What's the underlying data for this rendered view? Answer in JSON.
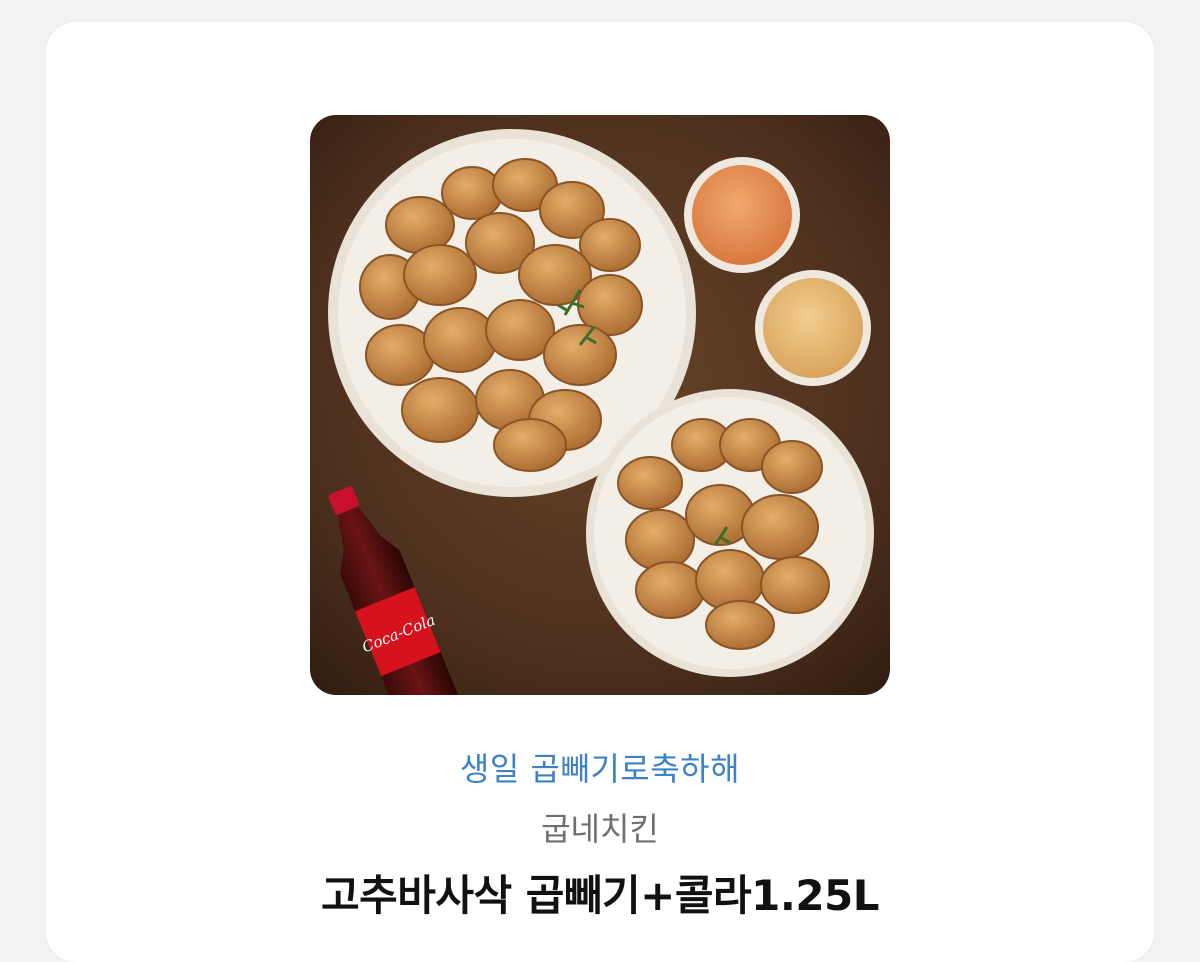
{
  "gift": {
    "image": {
      "alt": "치킨 두 접시, 소스 두 개, 콜라 1.25L",
      "bottle_label": "Coca-Cola"
    },
    "message": "생일 곱빼기로축하해",
    "brand": "굽네치킨",
    "product_name": "고추바사삭 곱빼기+콜라1.25L"
  },
  "colors": {
    "page_background": "#f2f2f4",
    "card_background": "#ffffff",
    "message_text": "#3d82c7",
    "brand_text": "#6e6e73",
    "product_text": "#111111",
    "table_wood": "#4a2e1c",
    "plate": "#f3eee6",
    "chicken": "#c98a45"
  }
}
